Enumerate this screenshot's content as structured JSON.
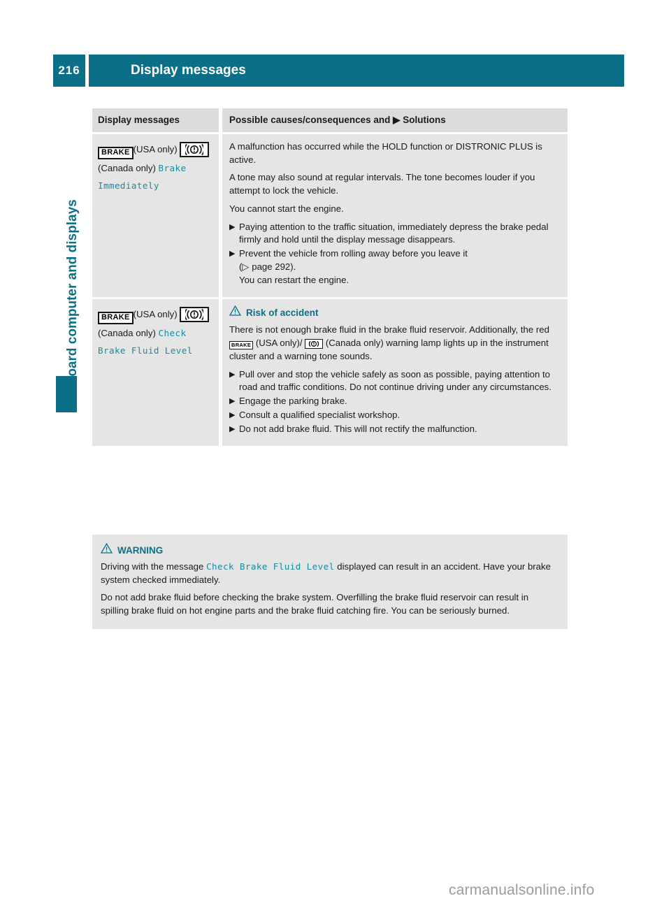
{
  "header": {
    "page_number": "216",
    "title": "Display messages"
  },
  "sidebar": {
    "chapter_label": "On-board computer and displays"
  },
  "table": {
    "columns": {
      "left": "Display messages",
      "right_pre": "Possible causes/consequences and",
      "right_post": "Solutions"
    },
    "rows": [
      {
        "left": {
          "usa_note": "(USA",
          "canada_note_pre": "only)",
          "canada_note": "(Canada",
          "canada_note_post": "only)",
          "message": "Brake Immediately",
          "icon_usa": "brake-warning-icon",
          "icon_canada": "brake-exclamation-icon"
        },
        "right": {
          "paragraphs": [
            "A malfunction has occurred while the HOLD function or DISTRONIC PLUS is active.",
            "A tone may also sound at regular intervals. The tone becomes louder if you attempt to lock the vehicle.",
            "You cannot start the engine."
          ],
          "bullets": [
            "Paying attention to the traffic situation, immediately depress the brake pedal firmly and hold until the display message disappears.",
            "Prevent the vehicle from rolling away before you leave it"
          ],
          "bullet2_ref": "page 292",
          "bullet2_tail": "You can restart the engine."
        }
      },
      {
        "left": {
          "usa_note": "(USA",
          "canada_note_pre": "only)",
          "canada_note": "(Canada",
          "canada_note_post": "only)",
          "message": "Check Brake Fluid Level",
          "icon_usa": "brake-warning-icon",
          "icon_canada": "brake-exclamation-icon"
        },
        "right": {
          "warning_title": "Risk of accident",
          "body_1": "There is not enough brake fluid in the brake fluid reservoir. Additionally, the red",
          "body_2": "(USA only)/",
          "body_3": "(Canada only) warning lamp lights up in the instrument cluster and a warning tone sounds.",
          "bullets": [
            "Pull over and stop the vehicle safely as soon as possible, paying attention to road and traffic conditions. Do not continue driving under any circumstances.",
            "Engage the parking brake.",
            "Consult a qualified specialist workshop.",
            "Do not add brake fluid. This will not rectify the malfunction."
          ]
        }
      }
    ]
  },
  "warning_box": {
    "title": "WARNING",
    "para1_pre": "Driving with the message",
    "para1_code": "Check Brake Fluid Level",
    "para1_post": "displayed can result in an accident. Have your brake system checked immediately.",
    "para2": "Do not add brake fluid before checking the brake system. Overfilling the brake fluid reservoir can result in spilling brake fluid on hot engine parts and the brake fluid catching fire. You can be seriously burned."
  },
  "watermark": "carmanualsonline.info",
  "icons": {
    "brake_label": "BRAKE",
    "solid_triangle": "▶",
    "hollow_triangle": "▷",
    "warning_triangle": "warning-triangle-icon"
  },
  "colors": {
    "accent_teal": "#0b7087",
    "code_teal": "#1b8a9e",
    "table_bg": "#e5e5e5",
    "table_head_bg": "#dcdcdc"
  }
}
